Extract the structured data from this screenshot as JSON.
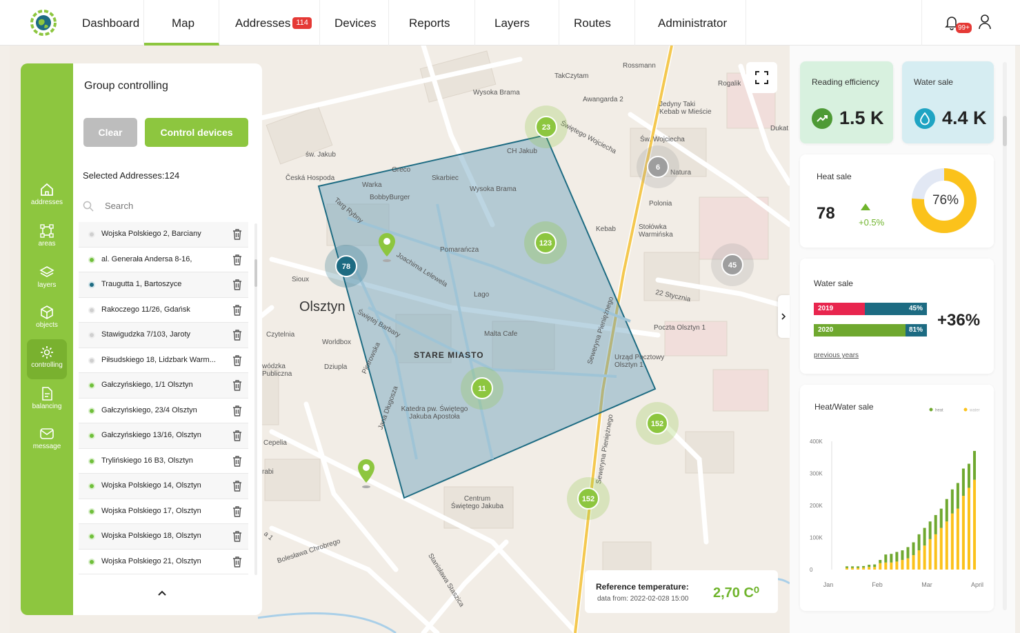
{
  "nav": {
    "items": [
      {
        "label": "Dashboard"
      },
      {
        "label": "Map"
      },
      {
        "label": "Addresses",
        "badge": "114"
      },
      {
        "label": "Devices"
      },
      {
        "label": "Reports"
      },
      {
        "label": "Layers"
      },
      {
        "label": "Routes"
      },
      {
        "label": "Administrator"
      }
    ],
    "active": "Map",
    "notification_badge": "99+"
  },
  "rail": {
    "items": [
      {
        "label": "addresses",
        "icon": "home-icon"
      },
      {
        "label": "areas",
        "icon": "areas-icon"
      },
      {
        "label": "layers",
        "icon": "layers-icon"
      },
      {
        "label": "objects",
        "icon": "cube-icon"
      },
      {
        "label": "controlling",
        "icon": "gear-icon"
      },
      {
        "label": "balancing",
        "icon": "document-icon"
      },
      {
        "label": "message",
        "icon": "mail-icon"
      }
    ],
    "active": "controlling"
  },
  "panel": {
    "title": "Group controlling",
    "clear_label": "Clear",
    "control_label": "Control devices",
    "selected_label": "Selected Addresses:124",
    "search_placeholder": "Search",
    "addresses": [
      {
        "name": "Wojska Polskiego 2, Barciany",
        "status": "grey"
      },
      {
        "name": "al. Generała Andersa 8-16,",
        "status": "green"
      },
      {
        "name": "Traugutta 1, Bartoszyce",
        "status": "teal"
      },
      {
        "name": "Rakoczego 11/26, Gdańsk",
        "status": "grey"
      },
      {
        "name": "Stawigudzka 7/103, Jaroty",
        "status": "grey"
      },
      {
        "name": "Piłsudskiego 18, Lidzbark Warm...",
        "status": "grey"
      },
      {
        "name": "Gałczyńskiego, 1/1 Olsztyn",
        "status": "green"
      },
      {
        "name": "Gałczyńskiego, 23/4 Olsztyn",
        "status": "green"
      },
      {
        "name": "Gałczyńskiego 13/16, Olsztyn",
        "status": "green"
      },
      {
        "name": "Trylińskiego 16 B3, Olsztyn",
        "status": "green"
      },
      {
        "name": "Wojska Polskiego 14, Olsztyn",
        "status": "green"
      },
      {
        "name": "Wojska Polskiego 17, Olsztyn",
        "status": "green"
      },
      {
        "name": "Wojska Polskiego 18, Olsztyn",
        "status": "green"
      },
      {
        "name": "Wojska Polskiego 21, Olsztyn",
        "status": "green"
      }
    ]
  },
  "map": {
    "labels": {
      "city": "Olsztyn",
      "old_town": "STARE MIASTO",
      "takczytam": "TakCzytam",
      "rossmann": "Rossmann",
      "rogalik": "Rogalik",
      "wysoka_brama_top": "Wysoka Brama",
      "awangarda": "Awangarda 2",
      "jedyny": "Jedyny Taki Kebab w Mieście",
      "dukat": "Dukat",
      "sw_wojciecha": "Św. Wojciecha",
      "sw_jakub": "św. Jakub",
      "ceska": "Česká Hospoda",
      "greco": "Greco",
      "skarbiec": "Skarbiec",
      "ch_jakub": "CH Jakub",
      "warka": "Warka",
      "bobby": "BobbyBurger",
      "wysoka_brama": "Wysoka Brama",
      "natura": "Natura",
      "polonia": "Polonia",
      "kebab": "Kebab",
      "stolowka": "Stołówka Warmińska",
      "pomarancza": "Pomarańcza",
      "sioux": "Sioux",
      "lago": "Lago",
      "czytelnia": "Czytelnia",
      "worldbox": "Worldbox",
      "malta": "Malta Cafe",
      "poczta": "Poczta Olsztyn 1",
      "urzad": "Urząd Pocztowy Olsztyn 1",
      "dziupla": "Dziupla",
      "wodzka": "wódzka Publiczna",
      "katedra": "Katedra pw. Świętego Jakuba Apostoła",
      "cepelia": "Cepelia",
      "centrum": "Centrum Świętego Jakuba",
      "street_22": "22 Stycznia",
      "street_seweryna": "Seweryna Pieniężnego",
      "street_seweryna2": "Seweryna Pieniężnego",
      "street_wojciecha": "Świętego Wojciecha",
      "street_lelewela": "Joachima Lelewela",
      "street_barbary": "Świętej Barbary",
      "street_dlugosza": "Jana Długosza",
      "street_chrobrego": "Bolesława Chrobrego",
      "street_staszica": "Stanisława Staszica",
      "street_piotrowska": "Piotrowska",
      "street_rybny": "Targ Rybny",
      "street_abi": "rabi",
      "street_a": "a 1"
    },
    "clusters": [
      {
        "label": "23",
        "tone": "green"
      },
      {
        "label": "6",
        "tone": "grey"
      },
      {
        "label": "123",
        "tone": "green"
      },
      {
        "label": "78",
        "tone": "teal"
      },
      {
        "label": "45",
        "tone": "grey"
      },
      {
        "label": "11",
        "tone": "green"
      },
      {
        "label": "152",
        "tone": "green"
      },
      {
        "label": "152",
        "tone": "green"
      }
    ]
  },
  "ref_temp": {
    "title": "Reference temperature:",
    "subtitle": "data from: 2022-02-028  15:00",
    "value": "2,70 C⁰"
  },
  "stats": {
    "reading": {
      "title": "Reading efficiency",
      "value": "1.5 K"
    },
    "water": {
      "title": "Water sale",
      "value": "4.4 K"
    },
    "heat": {
      "title": "Heat sale",
      "value": "78",
      "delta": "+0.5%",
      "percent_label": "76%",
      "percent": 0.76
    },
    "water_sale": {
      "title": "Water sale",
      "rows": [
        {
          "year": "2019",
          "pct_label": "45%",
          "pct": 0.45
        },
        {
          "year": "2020",
          "pct_label": "81%",
          "pct": 0.81
        }
      ],
      "change": "+36%",
      "link": "previous years"
    }
  },
  "colors": {
    "green": "#8dc63f",
    "teal": "#1d6b82",
    "yellow": "#fbc21b",
    "red": "#e8254e"
  },
  "chart_data": {
    "type": "bar",
    "title": "Heat/Water sale",
    "legend": [
      "heat",
      "water"
    ],
    "legend_position": "top-right",
    "x_tick_labels": [
      "Jan",
      "Feb",
      "Mar",
      "April"
    ],
    "y_tick_labels": [
      "0",
      "100K",
      "200K",
      "300K",
      "400K"
    ],
    "ylim": [
      0,
      400000
    ],
    "series": [
      {
        "name": "water",
        "values": [
          5000,
          5000,
          5000,
          6000,
          8000,
          8000,
          20000,
          22000,
          22000,
          25000,
          30000,
          35000,
          45000,
          60000,
          75000,
          95000,
          110000,
          130000,
          150000,
          175000,
          190000,
          230000,
          255000,
          280000
        ]
      },
      {
        "name": "heat",
        "values": [
          5000,
          5000,
          5000,
          5000,
          7000,
          8000,
          10000,
          25000,
          27000,
          30000,
          30000,
          35000,
          40000,
          50000,
          55000,
          55000,
          60000,
          60000,
          70000,
          75000,
          80000,
          85000,
          75000,
          90000
        ]
      }
    ]
  }
}
